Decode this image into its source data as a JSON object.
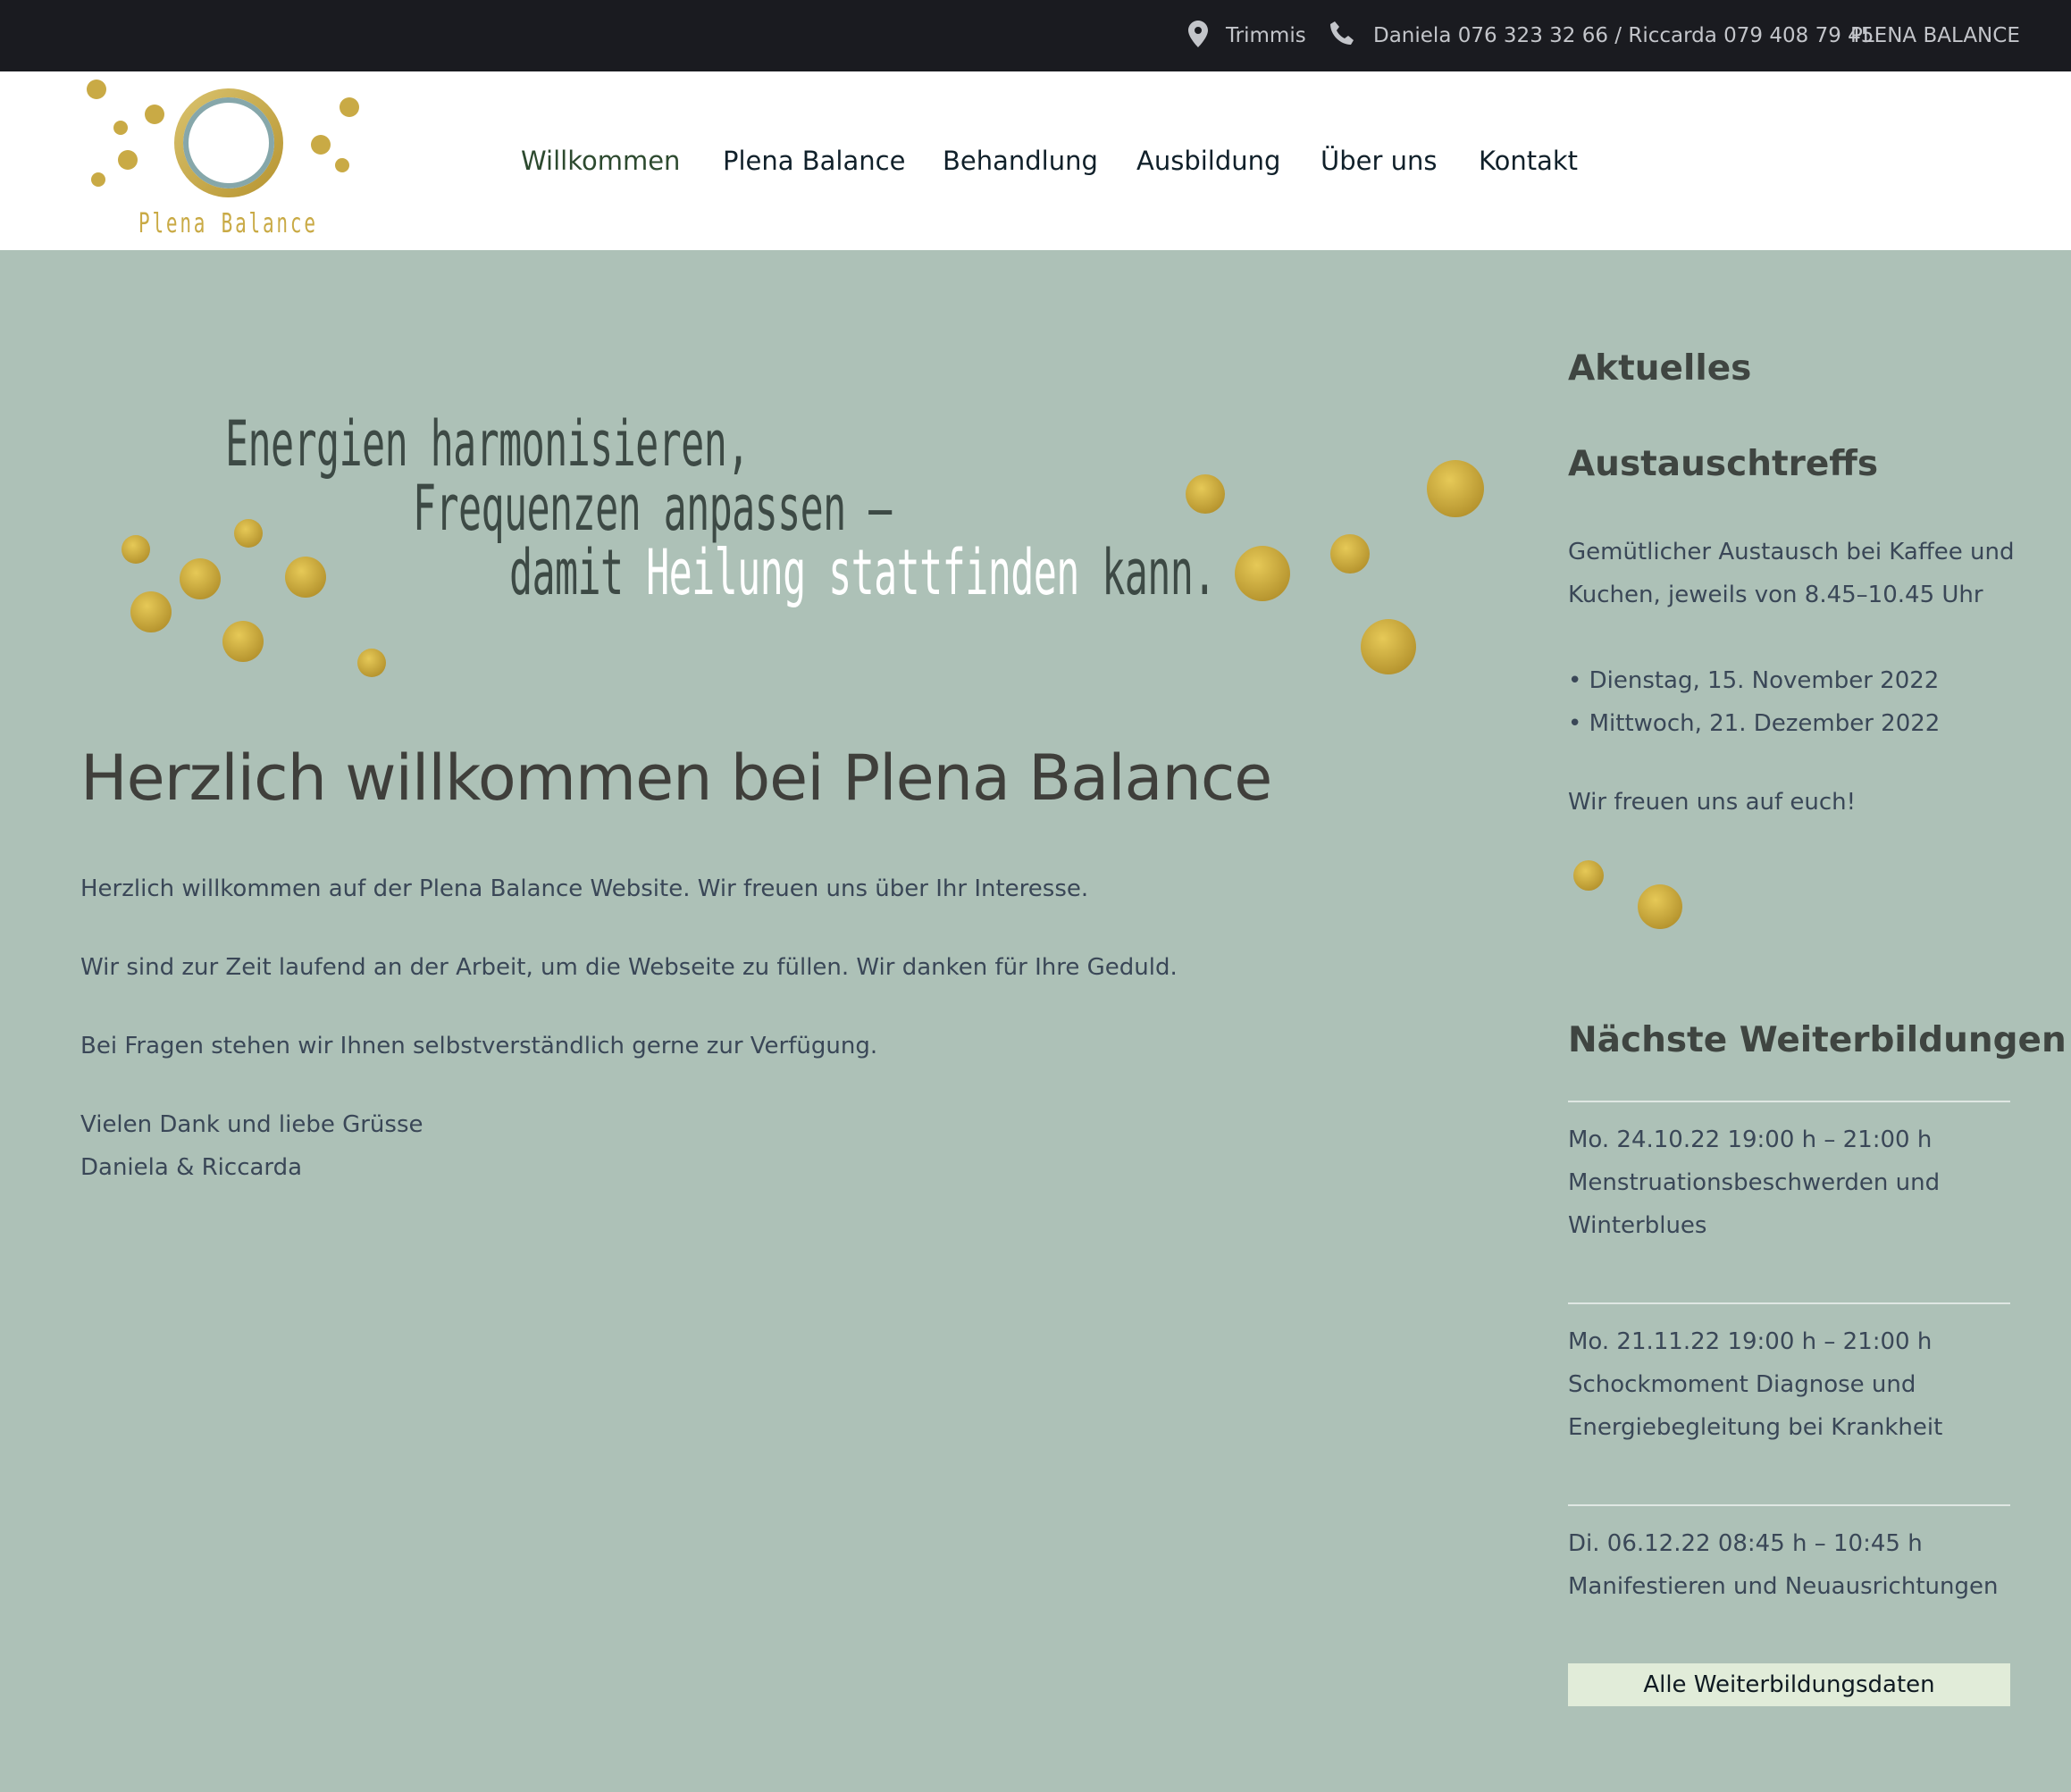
{
  "topbar": {
    "location": "Trimmis",
    "phones": "Daniela 076 323 32 66 / Riccarda 079 408 79 45",
    "brand_link": "PLENA BALANCE"
  },
  "logo": {
    "text": "Plena Balance"
  },
  "nav": {
    "items": [
      {
        "label": "Willkommen"
      },
      {
        "label": "Plena Balance"
      },
      {
        "label": "Behandlung"
      },
      {
        "label": "Ausbildung"
      },
      {
        "label": "Über uns"
      },
      {
        "label": "Kontakt"
      }
    ]
  },
  "hero": {
    "line1": "Energien harmonisieren,",
    "line2": "Frequenzen anpassen –",
    "line3_dark": "damit ",
    "line3_light": "Heilung stattfinden",
    "line3_end": " kann."
  },
  "main": {
    "title": "Herzlich willkommen bei Plena Balance",
    "p1": "Herzlich willkommen auf der Plena Balance Website. Wir freuen uns über Ihr Interesse.",
    "p2": "Wir sind zur Zeit laufend an der Arbeit, um die Webseite zu füllen. Wir danken für Ihre Geduld.",
    "p3": "Bei Fragen stehen wir Ihnen selbstverständlich gerne zur Verfügung.",
    "p4_line1": "Vielen Dank und liebe Grüsse",
    "p4_line2": "Daniela & Riccarda"
  },
  "sidebar": {
    "news_heading": "Aktuelles",
    "meet_heading": "Austauschtreffs",
    "meet_desc_line1": "Gemütlicher Austausch bei Kaffee und",
    "meet_desc_line2": "Kuchen, jeweils von 8.45–10.45 Uhr",
    "dates": [
      "• Dienstag, 15. November 2022",
      "• Mittwoch, 21. Dezember 2022"
    ],
    "closing": "Wir freuen uns auf euch!",
    "courses_heading": "Nächste Weiterbildungen",
    "courses": [
      {
        "line1": "Mo. 24.10.22 19:00 h – 21:00 h",
        "line2": "Menstruationsbeschwerden und",
        "line3": "Winterblues"
      },
      {
        "line1": "Mo. 21.11.22 19:00 h – 21:00 h",
        "line2": "Schockmoment Diagnose und",
        "line3": "Energiebegleitung bei Krankheit"
      },
      {
        "line1": "Di. 06.12.22 08:45 h – 10:45 h",
        "line2": "Manifestieren und Neuausrichtungen",
        "line3": ""
      }
    ],
    "all_dates_button": "Alle Weiterbildungsdaten"
  },
  "colors": {
    "topbar_bg": "#1a1b20",
    "page_bg": "#adc1b7",
    "gold": "#c9aa45",
    "button_bg": "#e1ecd9"
  }
}
